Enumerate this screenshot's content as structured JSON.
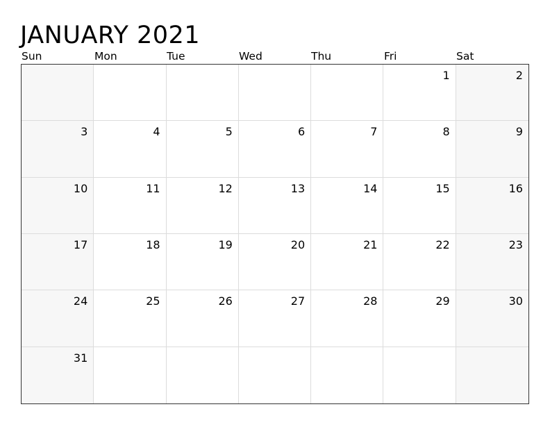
{
  "title": "JANUARY 2021",
  "weekdays": [
    "Sun",
    "Mon",
    "Tue",
    "Wed",
    "Thu",
    "Fri",
    "Sat"
  ],
  "weeks": [
    [
      "",
      "",
      "",
      "",
      "",
      "1",
      "2"
    ],
    [
      "3",
      "4",
      "5",
      "6",
      "7",
      "8",
      "9"
    ],
    [
      "10",
      "11",
      "12",
      "13",
      "14",
      "15",
      "16"
    ],
    [
      "17",
      "18",
      "19",
      "20",
      "21",
      "22",
      "23"
    ],
    [
      "24",
      "25",
      "26",
      "27",
      "28",
      "29",
      "30"
    ],
    [
      "31",
      "",
      "",
      "",
      "",
      "",
      ""
    ]
  ],
  "colors": {
    "weekend_fill": "#f7f7f7",
    "grid_line": "#dcdcdc",
    "border": "#333333"
  }
}
